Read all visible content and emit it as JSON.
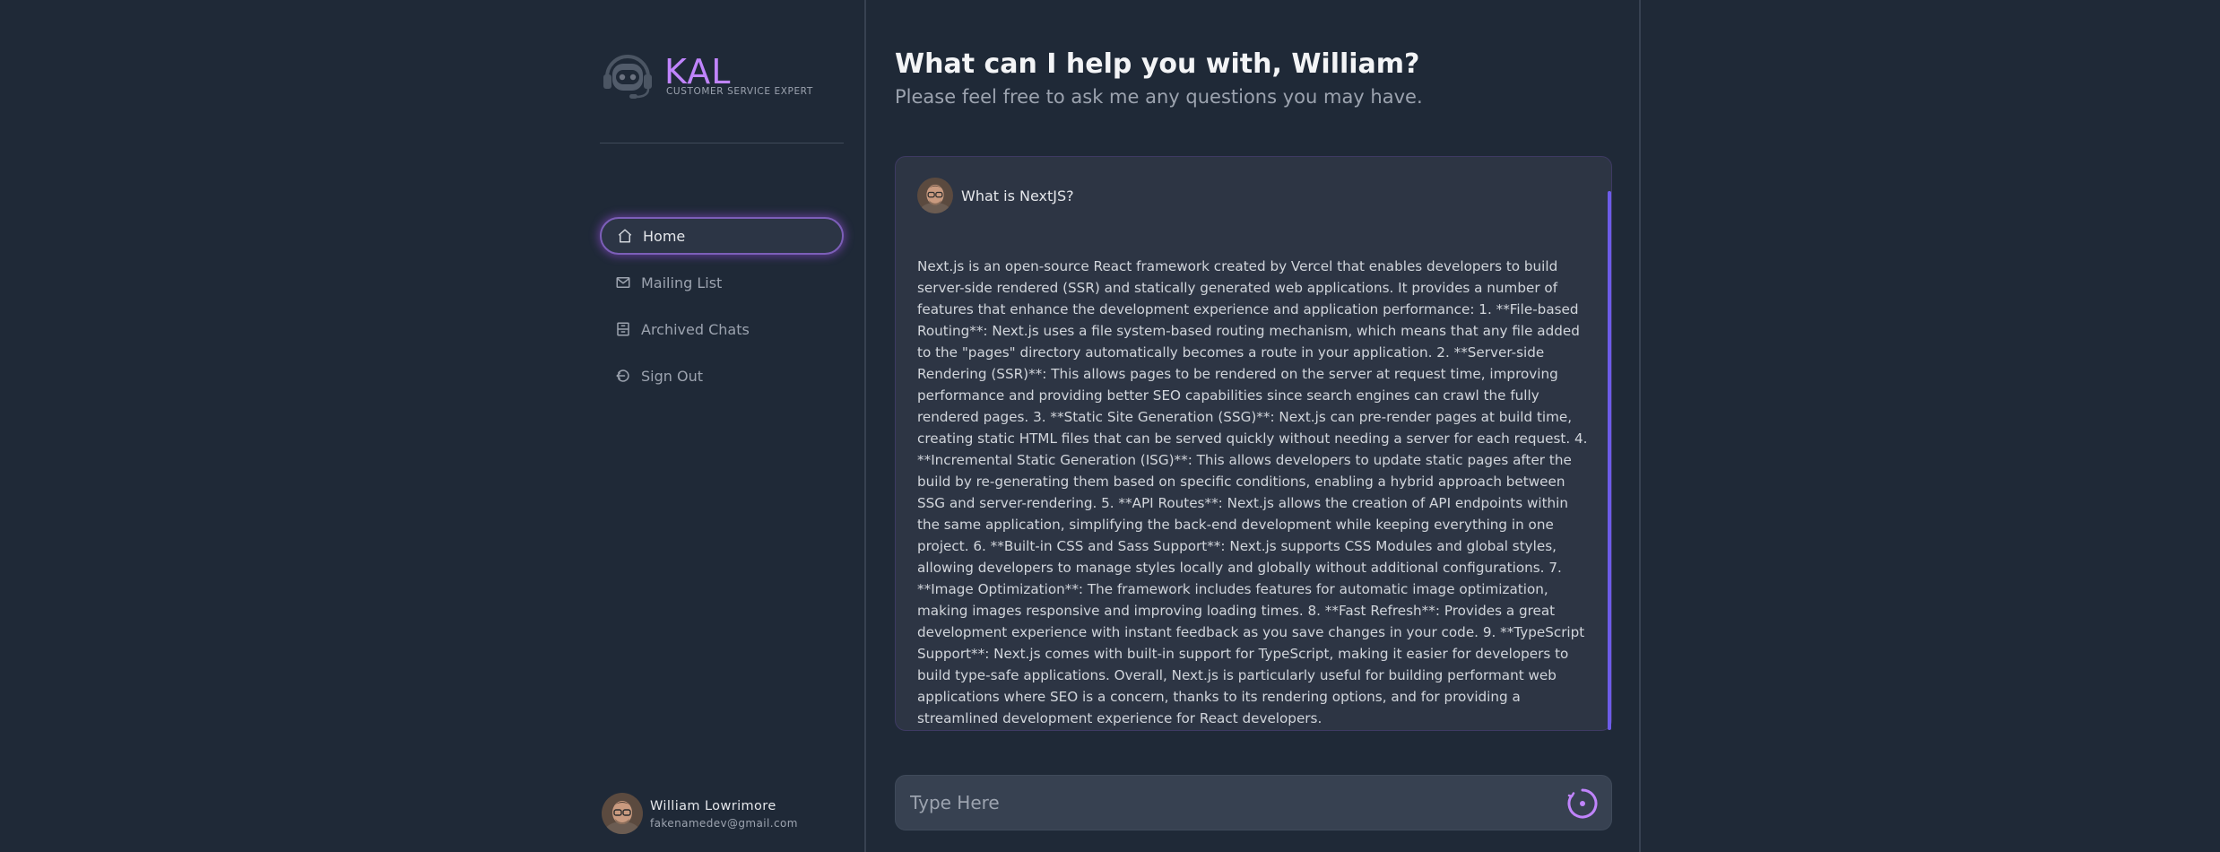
{
  "brand": {
    "name": "KAL",
    "tagline": "CUSTOMER SERVICE EXPERT",
    "logo_icon": "headset-robot-icon"
  },
  "nav": {
    "items": [
      {
        "label": "Home",
        "icon": "home-icon",
        "active": true
      },
      {
        "label": "Mailing List",
        "icon": "mail-icon",
        "active": false
      },
      {
        "label": "Archived Chats",
        "icon": "archive-icon",
        "active": false
      },
      {
        "label": "Sign Out",
        "icon": "sign-out-icon",
        "active": false
      }
    ]
  },
  "user": {
    "name": "William Lowrimore",
    "email": "fakenamedev@gmail.com"
  },
  "main": {
    "greeting": "What can I help you with, William?",
    "subtitle": "Please feel free to ask me any questions you may have."
  },
  "chat": {
    "question": "What is NextJS?",
    "answer": "Next.js is an open-source React framework created by Vercel that enables developers to build server-side rendered (SSR) and statically generated web applications. It provides a number of features that enhance the development experience and application performance: 1. **File-based Routing**: Next.js uses a file system-based routing mechanism, which means that any file added to the \"pages\" directory automatically becomes a route in your application. 2. **Server-side Rendering (SSR)**: This allows pages to be rendered on the server at request time, improving performance and providing better SEO capabilities since search engines can crawl the fully rendered pages. 3. **Static Site Generation (SSG)**: Next.js can pre-render pages at build time, creating static HTML files that can be served quickly without needing a server for each request. 4. **Incremental Static Generation (ISG)**: This allows developers to update static pages after the build by re-generating them based on specific conditions, enabling a hybrid approach between SSG and server-rendering. 5. **API Routes**: Next.js allows the creation of API endpoints within the same application, simplifying the back-end development while keeping everything in one project. 6. **Built-in CSS and Sass Support**: Next.js supports CSS Modules and global styles, allowing developers to manage styles locally and globally without additional configurations. 7. **Image Optimization**: The framework includes features for automatic image optimization, making images responsive and improving loading times. 8. **Fast Refresh**: Provides a great development experience with instant feedback as you save changes in your code. 9. **TypeScript Support**: Next.js comes with built-in support for TypeScript, making it easier for developers to build type-safe applications. Overall, Next.js is particularly useful for building performant web applications where SEO is a concern, thanks to its rendering options, and for providing a streamlined development experience for React developers."
  },
  "input": {
    "placeholder": "Type Here",
    "value": ""
  },
  "colors": {
    "background": "#1f2937",
    "accent": "#c084fc",
    "chat_card": "#2d3544",
    "scroll_accent": "#6d5ce8"
  }
}
